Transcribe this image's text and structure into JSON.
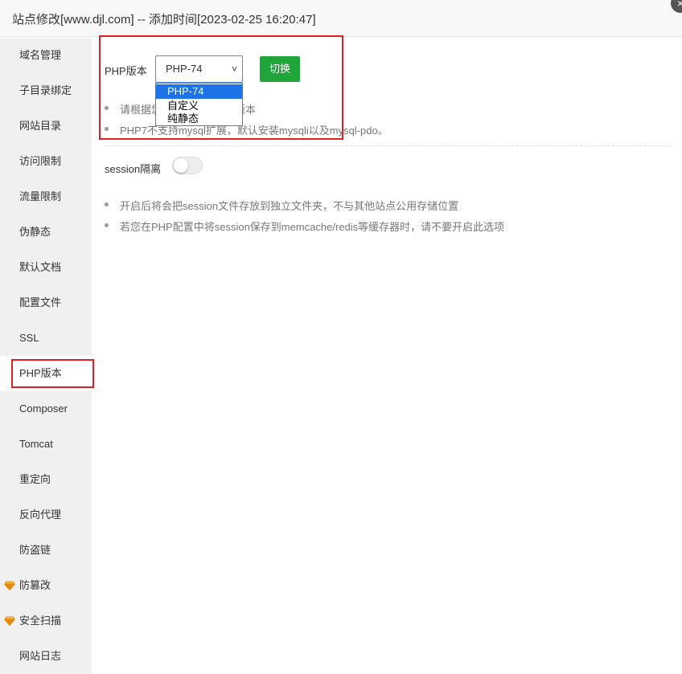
{
  "window": {
    "title": "站点修改[www.djl.com] -- 添加时间[2023-02-25 16:20:47]",
    "close_icon": "×"
  },
  "sidebar": {
    "items": [
      {
        "label": "域名管理"
      },
      {
        "label": "子目录绑定"
      },
      {
        "label": "网站目录"
      },
      {
        "label": "访问限制"
      },
      {
        "label": "流量限制"
      },
      {
        "label": "伪静态"
      },
      {
        "label": "默认文档"
      },
      {
        "label": "配置文件"
      },
      {
        "label": "SSL"
      },
      {
        "label": "PHP版本",
        "active": true
      },
      {
        "label": "Composer"
      },
      {
        "label": "Tomcat"
      },
      {
        "label": "重定向"
      },
      {
        "label": "反向代理"
      },
      {
        "label": "防盗链"
      },
      {
        "label": "防篡改",
        "icon": "diamond-icon"
      },
      {
        "label": "安全扫描",
        "icon": "diamond-icon"
      },
      {
        "label": "网站日志"
      }
    ]
  },
  "php": {
    "label": "PHP版本",
    "selected": "PHP-74",
    "switch_label": "切换",
    "options": [
      "PHP-74",
      "自定义",
      "纯静态"
    ],
    "notes": [
      "请根据您的程序需求选择版本",
      "PHP7不支持mysql扩展，默认安装mysqli以及mysql-pdo。"
    ]
  },
  "session": {
    "label": "session隔离",
    "enabled": false,
    "notes": [
      "开启后将会把session文件存放到独立文件夹，不与其他站点公用存储位置",
      "若您在PHP配置中将session保存到memcache/redis等缓存器时，请不要开启此选项"
    ]
  },
  "colors": {
    "accent_green": "#20a53a",
    "highlight_red": "#e02020",
    "select_blue": "#1e73e8",
    "gem_gold": "#f0a020"
  }
}
